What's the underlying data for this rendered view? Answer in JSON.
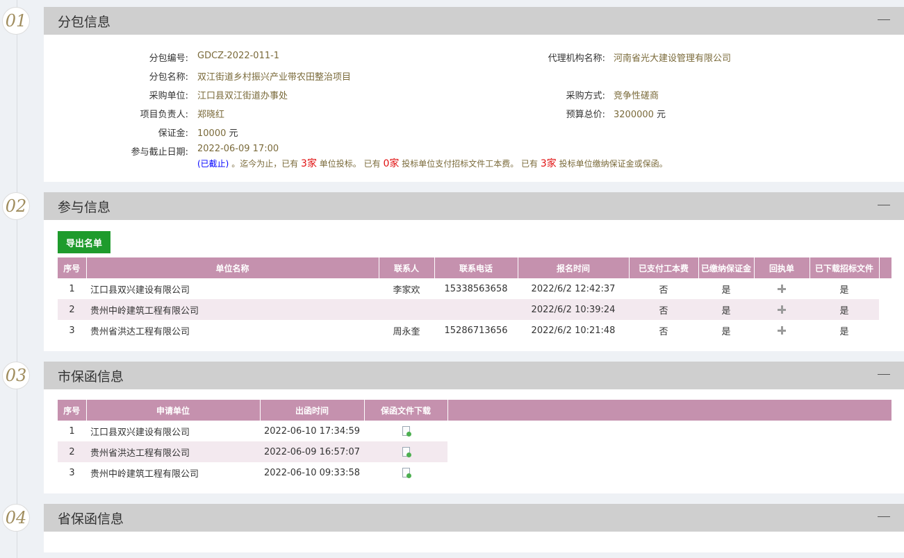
{
  "steps": [
    "01",
    "02",
    "03",
    "04"
  ],
  "section1": {
    "title": "分包信息",
    "fields": [
      {
        "label": "分包编号:",
        "value": "GDCZ-2022-011-1"
      },
      {
        "label": "分包名称:",
        "value": "双江街道乡村振兴产业带农田整治项目"
      },
      {
        "label": "采购单位:",
        "value": "江口县双江街道办事处"
      },
      {
        "label": "项目负责人:",
        "value": "郑晓红"
      },
      {
        "label": "保证金:",
        "value": "10000",
        "unit": "元"
      },
      {
        "label": "参与截止日期:",
        "value": "2022-06-09 17:00"
      }
    ],
    "right_fields": [
      {
        "label": "代理机构名称:",
        "value": "河南省光大建设管理有限公司"
      },
      {
        "label": "采购方式:",
        "value": "竞争性磋商"
      },
      {
        "label": "预算总价:",
        "value": "3200000",
        "unit": "元"
      }
    ],
    "status": {
      "closed": "(已截止)",
      "t1": "。迄今为止，已有",
      "n1": "3家",
      "t2": "单位投标。 已有",
      "n2": "0家",
      "t3": "投标单位支付招标文件工本费。 已有",
      "n3": "3家",
      "t4": "投标单位缴纳保证金或保函。"
    }
  },
  "section2": {
    "title": "参与信息",
    "export_label": "导出名单",
    "headers": [
      "序号",
      "单位名称",
      "联系人",
      "联系电话",
      "报名时间",
      "已支付工本费",
      "已缴纳保证金",
      "回执单",
      "已下载招标文件"
    ],
    "rows": [
      {
        "no": "1",
        "name": "江口县双兴建设有限公司",
        "contact": "李家欢",
        "phone": "15338563658",
        "time": "2022/6/2 12:42:37",
        "paid": "否",
        "deposit": "是",
        "downloaded": "是"
      },
      {
        "no": "2",
        "name": "贵州中岭建筑工程有限公司",
        "contact": "",
        "phone": "",
        "time": "2022/6/2 10:39:24",
        "paid": "否",
        "deposit": "是",
        "downloaded": "是"
      },
      {
        "no": "3",
        "name": "贵州省洪达工程有限公司",
        "contact": "周永奎",
        "phone": "15286713656",
        "time": "2022/6/2 10:21:48",
        "paid": "否",
        "deposit": "是",
        "downloaded": "是"
      }
    ]
  },
  "section3": {
    "title": "市保函信息",
    "headers": [
      "序号",
      "申请单位",
      "出函时间",
      "保函文件下载"
    ],
    "rows": [
      {
        "no": "1",
        "unit": "江口县双兴建设有限公司",
        "time": "2022-06-10 17:34:59"
      },
      {
        "no": "2",
        "unit": "贵州省洪达工程有限公司",
        "time": "2022-06-09 16:57:07"
      },
      {
        "no": "3",
        "unit": "贵州中岭建筑工程有限公司",
        "time": "2022-06-10 09:33:58"
      }
    ]
  },
  "section4": {
    "title": "省保函信息"
  }
}
